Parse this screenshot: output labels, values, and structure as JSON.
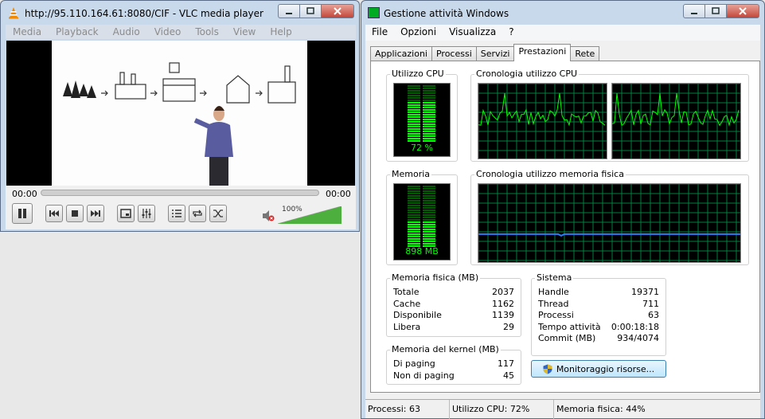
{
  "vlc": {
    "title": "http://95.110.164.61:8080/CIF - VLC media player",
    "menu": [
      "Media",
      "Playback",
      "Audio",
      "Video",
      "Tools",
      "View",
      "Help"
    ],
    "time_elapsed": "00:00",
    "time_total": "00:00",
    "seek_fraction": 0,
    "volume_label": "100%",
    "volume_fraction": 1.0
  },
  "taskmgr": {
    "title": "Gestione attività Windows",
    "menu": [
      "File",
      "Opzioni",
      "Visualizza",
      "?"
    ],
    "tabs": [
      "Applicazioni",
      "Processi",
      "Servizi",
      "Prestazioni",
      "Rete"
    ],
    "active_tab": "Prestazioni",
    "cpu_group_title": "Utilizzo CPU",
    "cpu_value": "72 %",
    "cpu_fraction": 0.72,
    "cpu_history_title": "Cronologia utilizzo CPU",
    "mem_group_title": "Memoria",
    "mem_value": "898 MB",
    "mem_fraction": 0.44,
    "mem_history_title": "Cronologia utilizzo memoria fisica",
    "physical_memory": {
      "title": "Memoria fisica (MB)",
      "rows": [
        {
          "label": "Totale",
          "value": "2037"
        },
        {
          "label": "Cache",
          "value": "1162"
        },
        {
          "label": "Disponibile",
          "value": "1139"
        },
        {
          "label": "Libera",
          "value": "29"
        }
      ]
    },
    "kernel_memory": {
      "title": "Memoria del kernel (MB)",
      "rows": [
        {
          "label": "Di paging",
          "value": "117"
        },
        {
          "label": "Non di paging",
          "value": "45"
        }
      ]
    },
    "system": {
      "title": "Sistema",
      "rows": [
        {
          "label": "Handle",
          "value": "19371"
        },
        {
          "label": "Thread",
          "value": "711"
        },
        {
          "label": "Processi",
          "value": "63"
        },
        {
          "label": "Tempo attività",
          "value": "0:00:18:18"
        },
        {
          "label": "Commit (MB)",
          "value": "934/4074"
        }
      ]
    },
    "resource_monitor_button": "Monitoraggio risorse...",
    "status": {
      "processes": "Processi: 63",
      "cpu": "Utilizzo CPU: 72%",
      "memory": "Memoria fisica: 44%"
    },
    "colors": {
      "meter_green": "#00ff00",
      "grid": "#008040",
      "memory_line": "#2a7fff"
    }
  }
}
